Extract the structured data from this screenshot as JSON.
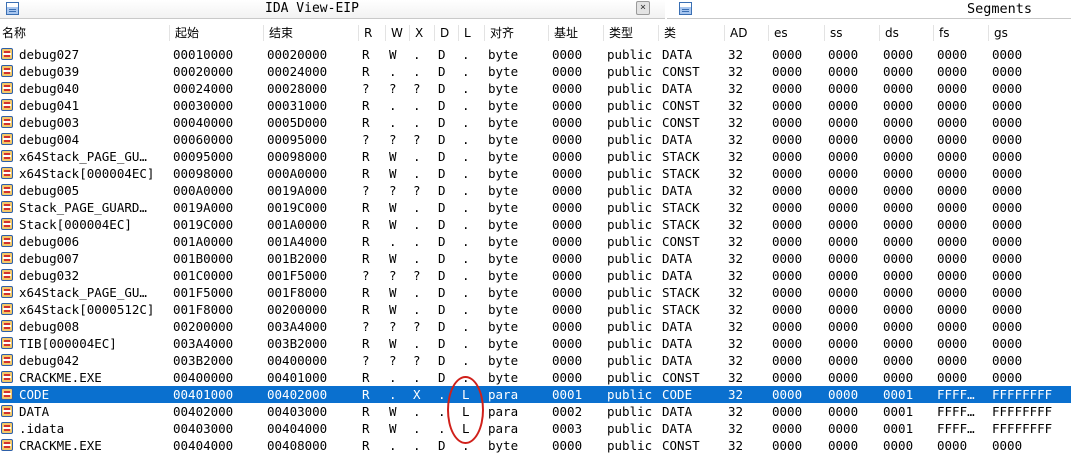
{
  "tabs": {
    "ida_view": "IDA View-EIP",
    "segments": "Segments",
    "close_glyph": "×"
  },
  "columns": [
    "名称",
    "起始",
    "结束",
    "R",
    "W",
    "X",
    "D",
    "L",
    "对齐",
    "基址",
    "类型",
    "类",
    "AD",
    "es",
    "ss",
    "ds",
    "fs",
    "gs"
  ],
  "selected_row_index": 20,
  "highlight": {
    "color": "#d0201a",
    "column": "L",
    "rows": [
      "CODE",
      "DATA",
      ".idata"
    ]
  },
  "colors": {
    "selection": "#0a70cf"
  },
  "rows": [
    [
      "debug027",
      "00010000",
      "00020000",
      "R",
      "W",
      ".",
      "D",
      ".",
      "byte",
      "0000",
      "public",
      "DATA",
      "32",
      "0000",
      "0000",
      "0000",
      "0000",
      "0000"
    ],
    [
      "debug039",
      "00020000",
      "00024000",
      "R",
      ".",
      ".",
      "D",
      ".",
      "byte",
      "0000",
      "public",
      "CONST",
      "32",
      "0000",
      "0000",
      "0000",
      "0000",
      "0000"
    ],
    [
      "debug040",
      "00024000",
      "00028000",
      "?",
      "?",
      "?",
      "D",
      ".",
      "byte",
      "0000",
      "public",
      "DATA",
      "32",
      "0000",
      "0000",
      "0000",
      "0000",
      "0000"
    ],
    [
      "debug041",
      "00030000",
      "00031000",
      "R",
      ".",
      ".",
      "D",
      ".",
      "byte",
      "0000",
      "public",
      "CONST",
      "32",
      "0000",
      "0000",
      "0000",
      "0000",
      "0000"
    ],
    [
      "debug003",
      "00040000",
      "0005D000",
      "R",
      ".",
      ".",
      "D",
      ".",
      "byte",
      "0000",
      "public",
      "CONST",
      "32",
      "0000",
      "0000",
      "0000",
      "0000",
      "0000"
    ],
    [
      "debug004",
      "00060000",
      "00095000",
      "?",
      "?",
      "?",
      "D",
      ".",
      "byte",
      "0000",
      "public",
      "DATA",
      "32",
      "0000",
      "0000",
      "0000",
      "0000",
      "0000"
    ],
    [
      "x64Stack_PAGE_GU…",
      "00095000",
      "00098000",
      "R",
      "W",
      ".",
      "D",
      ".",
      "byte",
      "0000",
      "public",
      "STACK",
      "32",
      "0000",
      "0000",
      "0000",
      "0000",
      "0000"
    ],
    [
      "x64Stack[000004EC]",
      "00098000",
      "000A0000",
      "R",
      "W",
      ".",
      "D",
      ".",
      "byte",
      "0000",
      "public",
      "STACK",
      "32",
      "0000",
      "0000",
      "0000",
      "0000",
      "0000"
    ],
    [
      "debug005",
      "000A0000",
      "0019A000",
      "?",
      "?",
      "?",
      "D",
      ".",
      "byte",
      "0000",
      "public",
      "DATA",
      "32",
      "0000",
      "0000",
      "0000",
      "0000",
      "0000"
    ],
    [
      "Stack_PAGE_GUARD…",
      "0019A000",
      "0019C000",
      "R",
      "W",
      ".",
      "D",
      ".",
      "byte",
      "0000",
      "public",
      "STACK",
      "32",
      "0000",
      "0000",
      "0000",
      "0000",
      "0000"
    ],
    [
      "Stack[000004EC]",
      "0019C000",
      "001A0000",
      "R",
      "W",
      ".",
      "D",
      ".",
      "byte",
      "0000",
      "public",
      "STACK",
      "32",
      "0000",
      "0000",
      "0000",
      "0000",
      "0000"
    ],
    [
      "debug006",
      "001A0000",
      "001A4000",
      "R",
      ".",
      ".",
      "D",
      ".",
      "byte",
      "0000",
      "public",
      "CONST",
      "32",
      "0000",
      "0000",
      "0000",
      "0000",
      "0000"
    ],
    [
      "debug007",
      "001B0000",
      "001B2000",
      "R",
      "W",
      ".",
      "D",
      ".",
      "byte",
      "0000",
      "public",
      "DATA",
      "32",
      "0000",
      "0000",
      "0000",
      "0000",
      "0000"
    ],
    [
      "debug032",
      "001C0000",
      "001F5000",
      "?",
      "?",
      "?",
      "D",
      ".",
      "byte",
      "0000",
      "public",
      "DATA",
      "32",
      "0000",
      "0000",
      "0000",
      "0000",
      "0000"
    ],
    [
      "x64Stack_PAGE_GU…",
      "001F5000",
      "001F8000",
      "R",
      "W",
      ".",
      "D",
      ".",
      "byte",
      "0000",
      "public",
      "STACK",
      "32",
      "0000",
      "0000",
      "0000",
      "0000",
      "0000"
    ],
    [
      "x64Stack[0000512C]",
      "001F8000",
      "00200000",
      "R",
      "W",
      ".",
      "D",
      ".",
      "byte",
      "0000",
      "public",
      "STACK",
      "32",
      "0000",
      "0000",
      "0000",
      "0000",
      "0000"
    ],
    [
      "debug008",
      "00200000",
      "003A4000",
      "?",
      "?",
      "?",
      "D",
      ".",
      "byte",
      "0000",
      "public",
      "DATA",
      "32",
      "0000",
      "0000",
      "0000",
      "0000",
      "0000"
    ],
    [
      "TIB[000004EC]",
      "003A4000",
      "003B2000",
      "R",
      "W",
      ".",
      "D",
      ".",
      "byte",
      "0000",
      "public",
      "DATA",
      "32",
      "0000",
      "0000",
      "0000",
      "0000",
      "0000"
    ],
    [
      "debug042",
      "003B2000",
      "00400000",
      "?",
      "?",
      "?",
      "D",
      ".",
      "byte",
      "0000",
      "public",
      "DATA",
      "32",
      "0000",
      "0000",
      "0000",
      "0000",
      "0000"
    ],
    [
      "CRACKME.EXE",
      "00400000",
      "00401000",
      "R",
      ".",
      ".",
      "D",
      ".",
      "byte",
      "0000",
      "public",
      "CONST",
      "32",
      "0000",
      "0000",
      "0000",
      "0000",
      "0000"
    ],
    [
      "CODE",
      "00401000",
      "00402000",
      "R",
      ".",
      "X",
      ".",
      "L",
      "para",
      "0001",
      "public",
      "CODE",
      "32",
      "0000",
      "0000",
      "0001",
      "FFFF…",
      "FFFFFFFF"
    ],
    [
      "DATA",
      "00402000",
      "00403000",
      "R",
      "W",
      ".",
      ".",
      "L",
      "para",
      "0002",
      "public",
      "DATA",
      "32",
      "0000",
      "0000",
      "0001",
      "FFFF…",
      "FFFFFFFF"
    ],
    [
      ".idata",
      "00403000",
      "00404000",
      "R",
      "W",
      ".",
      ".",
      "L",
      "para",
      "0003",
      "public",
      "DATA",
      "32",
      "0000",
      "0000",
      "0001",
      "FFFF…",
      "FFFFFFFF"
    ],
    [
      "CRACKME.EXE",
      "00404000",
      "00408000",
      "R",
      ".",
      ".",
      "D",
      ".",
      "byte",
      "0000",
      "public",
      "CONST",
      "32",
      "0000",
      "0000",
      "0000",
      "0000",
      "0000"
    ]
  ]
}
